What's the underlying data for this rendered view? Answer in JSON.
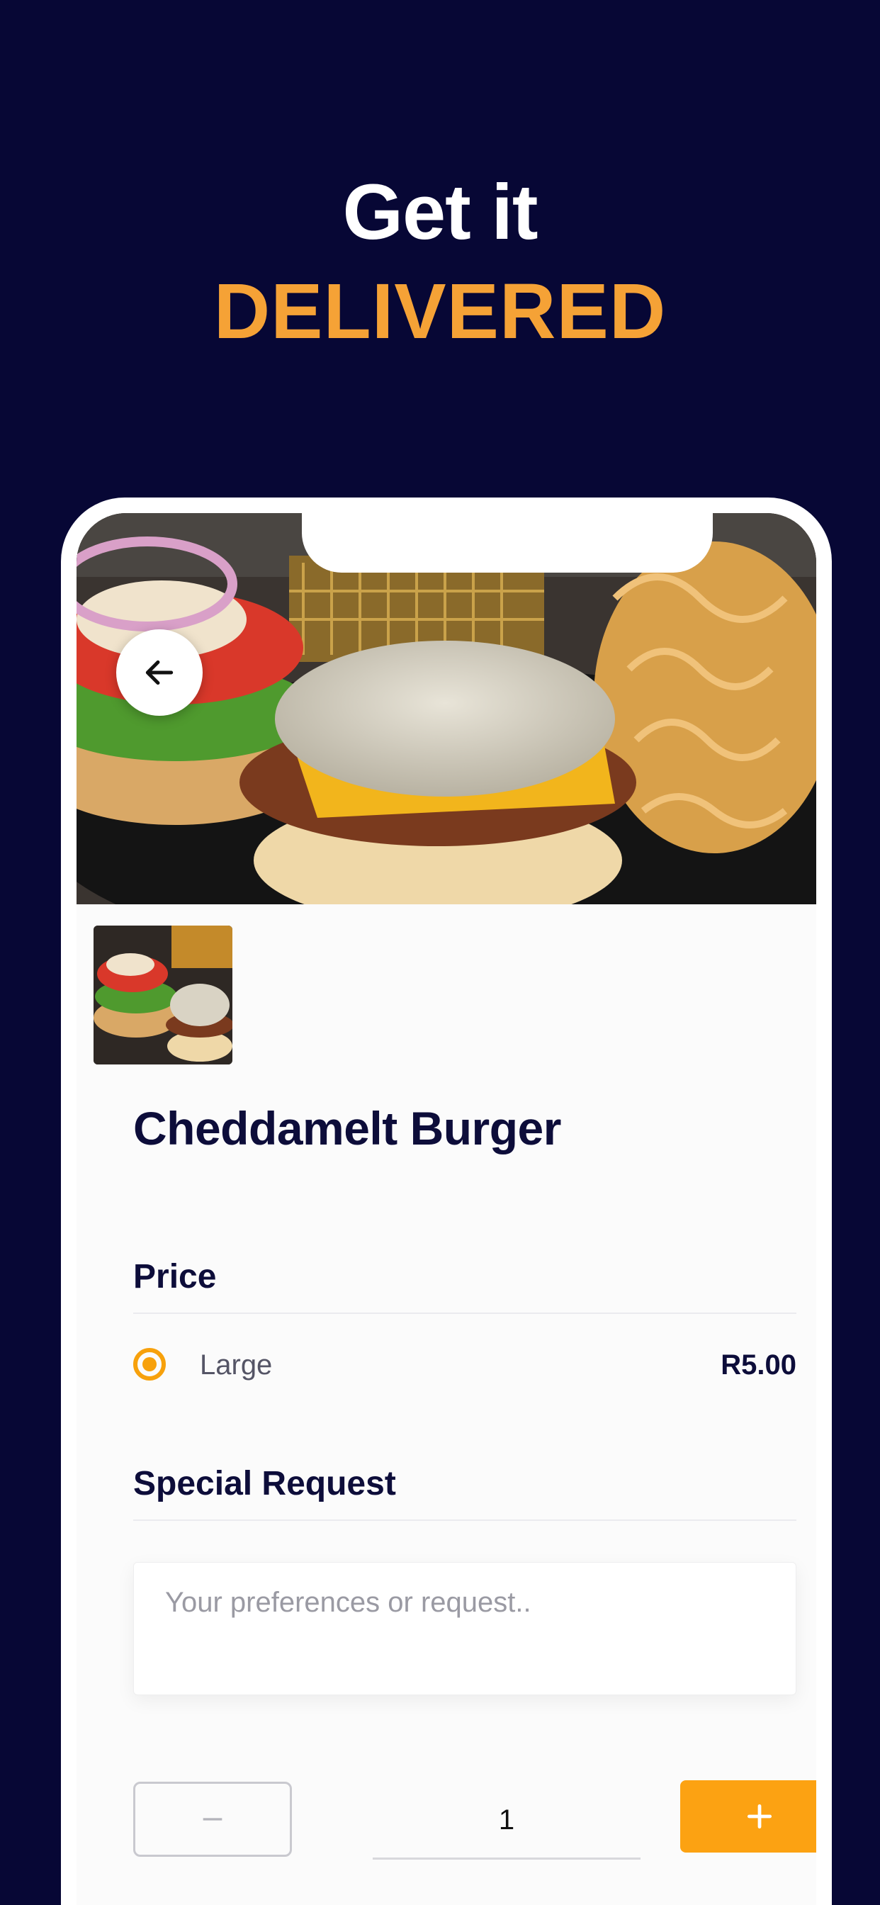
{
  "headline": {
    "line1": "Get it",
    "line2": "DELIVERED"
  },
  "product": {
    "title": "Cheddamelt Burger",
    "image_description_icon": "burger-photo"
  },
  "price_section": {
    "label": "Price",
    "options": [
      {
        "label": "Large",
        "price": "R5.00",
        "selected": true
      }
    ]
  },
  "special_request": {
    "label": "Special Request",
    "placeholder": "Your preferences or request..",
    "value": ""
  },
  "quantity": {
    "value": "1",
    "minus_icon": "minus-icon",
    "plus_icon": "plus-icon"
  },
  "colors": {
    "background": "#070735",
    "accent": "#f5a236",
    "button_orange": "#fca212",
    "title_navy": "#0d0d3a"
  },
  "icons": {
    "back": "arrow-left-icon"
  }
}
